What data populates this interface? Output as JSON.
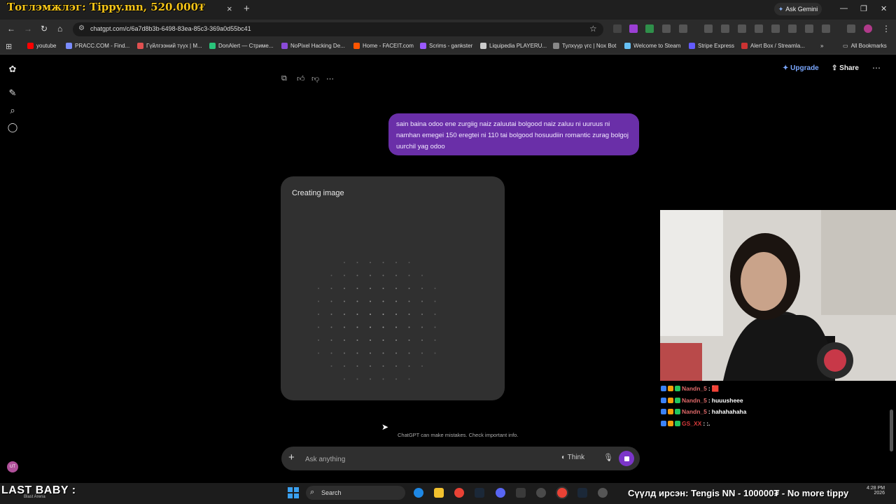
{
  "browser": {
    "overlay_top_text": "Тоглэмжлэг: Tippy.mn, 520.000₮",
    "tab_close": "×",
    "tab_new": "+",
    "ask_gemini": "Ask Gemini",
    "url": "chatgpt.com/c/6a7d8b3b-6498-83ea-85c3-369a0d55bc41",
    "bookmarks": [
      {
        "label": "youtube",
        "color": "#ff0000"
      },
      {
        "label": "PRACC.COM - Find...",
        "color": "#7a8cff"
      },
      {
        "label": "Гүйлгээний түүх | M...",
        "color": "#e05050"
      },
      {
        "label": "DonAlert — Стриме...",
        "color": "#29c47a"
      },
      {
        "label": "NoPixel Hacking De...",
        "color": "#8a4bd8"
      },
      {
        "label": "Home - FACEIT.com",
        "color": "#ff5500"
      },
      {
        "label": "Scrims - gankster",
        "color": "#9b59ff"
      },
      {
        "label": "Liquipedia PLAYERU...",
        "color": "#cccccc"
      },
      {
        "label": "Тулхүүр үгс | Nox Bot",
        "color": "#888888"
      },
      {
        "label": "Welcome to Steam",
        "color": "#66c0f4"
      },
      {
        "label": "Stripe Express",
        "color": "#635bff"
      },
      {
        "label": "Alert Box / Streamla...",
        "color": "#cc3333"
      }
    ],
    "bookmarks_overflow": "»",
    "all_bookmarks": "All Bookmarks"
  },
  "chat": {
    "upgrade_label": "Upgrade",
    "share_label": "Share",
    "user_message": "sain baina odoo ene zurgiig naiz zaluutai bolgood naiz zaluu ni uuruus ni namhan emegei 150 eregtei ni 110 tai bolgood hosuudiin romantic zurag bolgoj uurchil yag odoo",
    "creating_image": "Creating image",
    "disclaimer": "ChatGPT can make mistakes. Check important info.",
    "input_placeholder": "Ask anything",
    "think_label": "Think",
    "avatar_initials": "UT"
  },
  "stream_chat": [
    {
      "user": "Nandn_5",
      "text": "🟥",
      "color": "#e06a6a"
    },
    {
      "user": "Nandn_5",
      "text": "huuusheee",
      "color": "#e06a6a"
    },
    {
      "user": "Nandn_5",
      "text": "hahahahaha",
      "color": "#e06a6a"
    },
    {
      "user": "GS_XX",
      "text": ":.",
      "color": "#d43a3a"
    }
  ],
  "stream_chat_sep": ":",
  "taskbar": {
    "last_baby": "LAST BABY :",
    "last_baby_sub": "Blast Arena",
    "search_label": "Search",
    "ticker": "Сүүлд ирсэн:  Tengis NN - 100000₮ - No more tippy",
    "clock_time": "4:28 PM",
    "clock_date": "2026"
  },
  "colors": {
    "user_bubble": "#6a2fa8",
    "accent": "#7b35c9"
  }
}
